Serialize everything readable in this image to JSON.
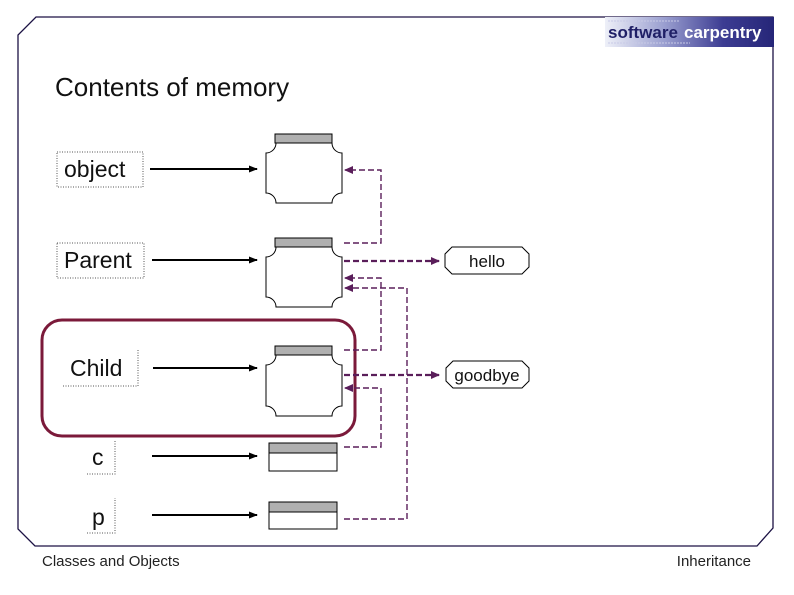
{
  "slide": {
    "title": "Contents of memory"
  },
  "logo": {
    "word1": "software",
    "word2": "carpentry"
  },
  "diagram": {
    "variables": [
      {
        "name": "object",
        "kind": "class"
      },
      {
        "name": "Parent",
        "kind": "class"
      },
      {
        "name": "Child",
        "kind": "class"
      },
      {
        "name": "c",
        "kind": "instance"
      },
      {
        "name": "p",
        "kind": "instance"
      }
    ],
    "strings": [
      "hello",
      "goodbye"
    ],
    "highlighted": "Child",
    "references": [
      {
        "from": "Parent",
        "to": "object"
      },
      {
        "from": "Parent",
        "to": "hello"
      },
      {
        "from": "Child",
        "to": "Parent"
      },
      {
        "from": "Child",
        "to": "goodbye"
      },
      {
        "from": "c",
        "to": "Child"
      },
      {
        "from": "p",
        "to": "Parent"
      }
    ]
  },
  "footer": {
    "left": "Classes and Objects",
    "right": "Inheritance"
  },
  "colors": {
    "highlight": "#7b1a3a",
    "reference": "#5a1e5a",
    "frame": "#1c1244",
    "logo_dark": "#2a2a80"
  }
}
